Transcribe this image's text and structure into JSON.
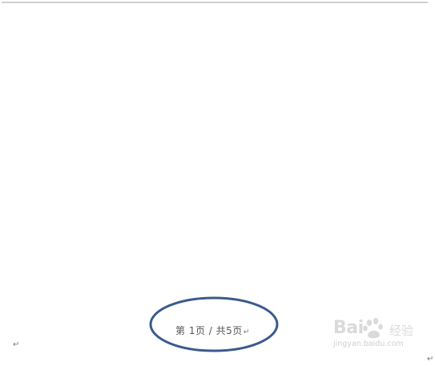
{
  "document": {
    "footer": {
      "page_number_text": "第 1页 / 共5页",
      "paragraph_mark": "↵"
    },
    "paragraph_mark_left": "↵",
    "paragraph_mark_right": "↵",
    "annotation": {
      "shape": "ellipse",
      "color": "#3a5a8c"
    },
    "rule_color": "#d0d0d0"
  },
  "watermark": {
    "logo_left": "Bai",
    "logo_right": "",
    "name": "经验",
    "url": "jingyan.baidu.com"
  }
}
